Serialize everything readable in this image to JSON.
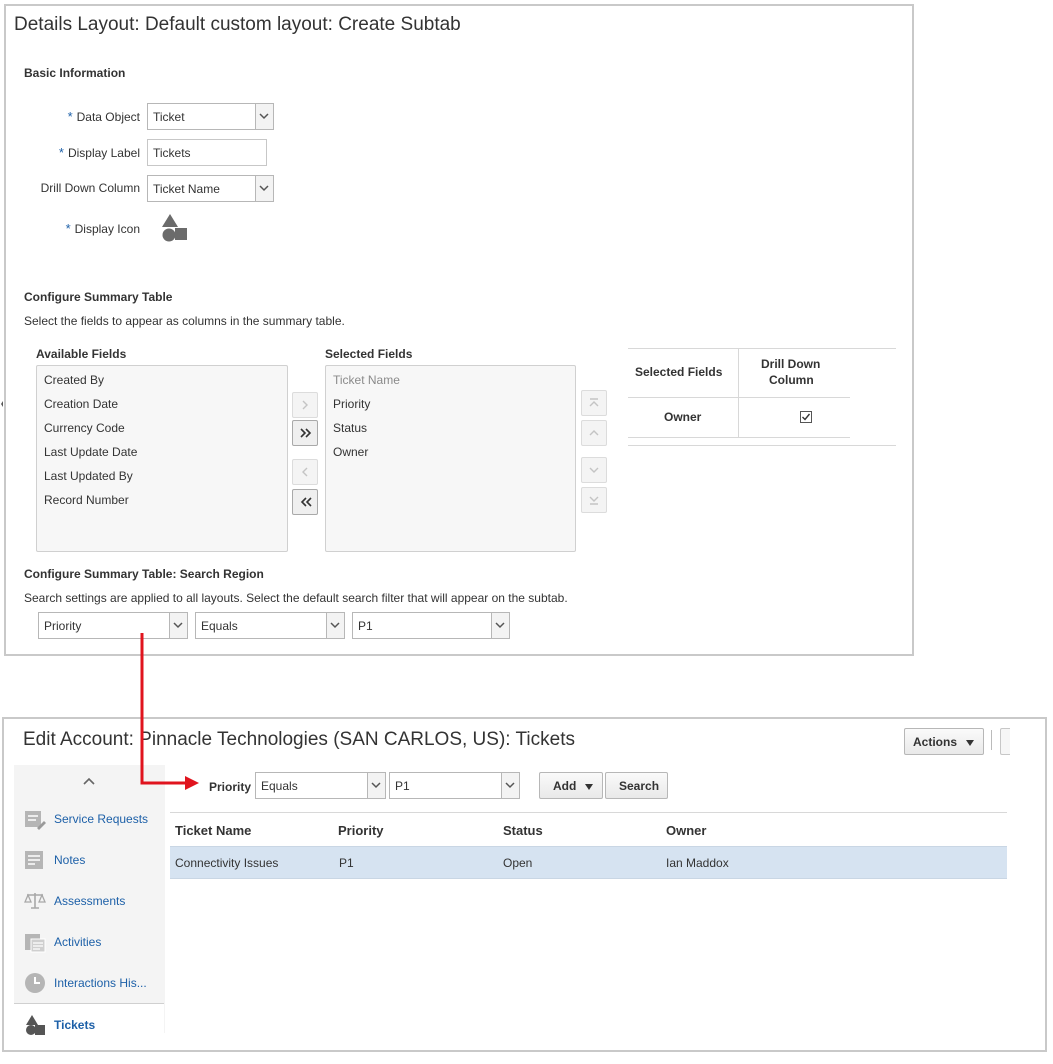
{
  "layout_panel": {
    "title": "Details Layout: Default custom layout: Create Subtab",
    "basic_info": {
      "heading": "Basic Information",
      "data_object_label": "Data Object",
      "data_object_value": "Ticket",
      "display_label_label": "Display Label",
      "display_label_value": "Tickets",
      "drill_down_label": "Drill Down Column",
      "drill_down_value": "Ticket Name",
      "display_icon_label": "Display Icon",
      "required_marker": "*"
    },
    "summary": {
      "heading": "Configure Summary Table",
      "description": "Select the fields to appear as columns in the summary table.",
      "available_label": "Available Fields",
      "available_fields": [
        "Created By",
        "Creation Date",
        "Currency Code",
        "Last Update Date",
        "Last Updated By",
        "Record Number"
      ],
      "selected_label": "Selected Fields",
      "selected_fields": [
        "Ticket Name",
        "Priority",
        "Status",
        "Owner"
      ],
      "drill_table": {
        "col1": "Selected Fields",
        "col2_line1": "Drill Down",
        "col2_line2": "Column",
        "row_field": "Owner",
        "row_checked": true
      }
    },
    "search_region": {
      "heading": "Configure Summary Table: Search Region",
      "description": "Search settings are applied to all layouts. Select the default search filter that will appear on the subtab.",
      "field": "Priority",
      "operator": "Equals",
      "value": "P1"
    }
  },
  "account_panel": {
    "title_prefix": "Edit Account: Pinnacle Technologies (SAN CARLOS, US): ",
    "title_suffix": "Tickets",
    "actions_label": "Actions",
    "nav": [
      {
        "label": "Service Requests",
        "icon": "service-request-icon"
      },
      {
        "label": "Notes",
        "icon": "notes-icon"
      },
      {
        "label": "Assessments",
        "icon": "assessments-icon"
      },
      {
        "label": "Activities",
        "icon": "activities-icon"
      },
      {
        "label": "Interactions His...",
        "icon": "interactions-icon"
      },
      {
        "label": "Tickets",
        "icon": "tickets-icon"
      }
    ],
    "search": {
      "field_label": "Priority",
      "operator": "Equals",
      "value": "P1",
      "add_label": "Add",
      "search_label": "Search"
    },
    "table": {
      "headers": [
        "Ticket Name",
        "Priority",
        "Status",
        "Owner"
      ],
      "rows": [
        {
          "ticket_name": "Connectivity Issues",
          "priority": "P1",
          "status": "Open",
          "owner": "Ian Maddox"
        }
      ]
    }
  },
  "colors": {
    "link": "#1d60a8",
    "connector": "#e0141e",
    "row_highlight": "#d6e3f1",
    "required": "#1d60a8"
  }
}
